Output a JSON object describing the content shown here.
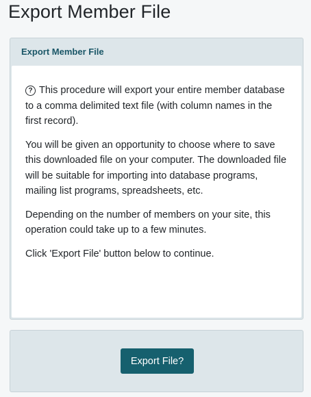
{
  "page": {
    "title": "Export Member File"
  },
  "card": {
    "header": "Export Member File",
    "help_icon": "question-circle-icon",
    "paragraphs": [
      "This procedure will export your entire member database to a comma delimited text file (with column names in the first record).",
      "You will be given an opportunity to choose where to save this downloaded file on your computer. The downloaded file will be suitable for importing into database programs, mailing list programs, spreadsheets, etc.",
      "Depending on the number of members on your site, this operation could take up to a few minutes.",
      "Click 'Export File' button below to continue."
    ]
  },
  "actions": {
    "export_label": "Export File?"
  },
  "colors": {
    "accent": "#16606e",
    "header_text": "#1a5667",
    "panel_bg": "#dde6ea"
  }
}
